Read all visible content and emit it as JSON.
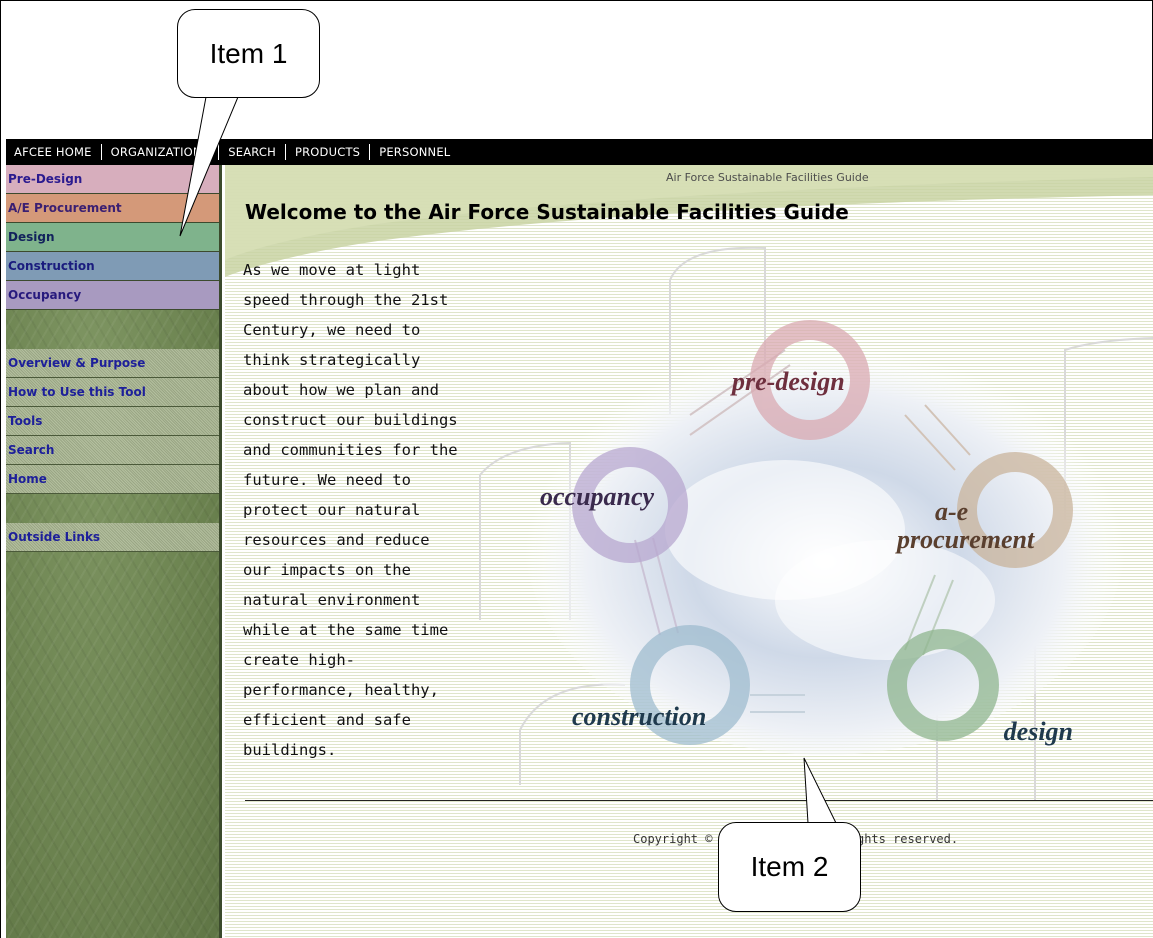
{
  "callouts": {
    "item1": "Item 1",
    "item2": "Item 2"
  },
  "topnav": [
    "AFCEE HOME",
    "ORGANIZATIONS",
    "SEARCH",
    "PRODUCTS",
    "PERSONNEL"
  ],
  "sidebar": {
    "phases": [
      "Pre-Design",
      "A/E Procurement",
      "Design",
      "Construction",
      "Occupancy"
    ],
    "links": [
      "Overview & Purpose",
      "How to Use this Tool",
      "Tools",
      "Search",
      "Home"
    ],
    "outside": "Outside Links"
  },
  "main": {
    "site_caption": "Air Force Sustainable Facilities Guide",
    "title": "Welcome to the Air Force Sustainable Facilities Guide",
    "intro_lines": [
      "As we move at light",
      "speed through the 21st",
      "Century, we need to",
      "think strategically",
      "about how we plan and",
      "construct our buildings",
      "and communities for the",
      "future. We need to",
      "protect our natural",
      "resources and reduce",
      "our impacts on the",
      "natural environment",
      "while at the same time",
      "create high-",
      "performance, healthy,",
      "efficient and safe",
      "buildings."
    ],
    "cycle": {
      "pre_design": "pre-design",
      "ae_1": "a-e",
      "ae_2": "procurement",
      "design": "design",
      "construction": "construction",
      "occupancy": "occupancy"
    },
    "copyright": "Copyright © 2002. AFCEE. All rights reserved."
  },
  "colors": {
    "pre_design": "#d7aebd",
    "ae_procurement": "#d49979",
    "design": "#7fb38c",
    "construction": "#7f9bb5",
    "occupancy": "#a89ac0",
    "sidebar_bg": "#6c8350",
    "nav_bg": "#000000",
    "link": "#1d1f9a"
  }
}
